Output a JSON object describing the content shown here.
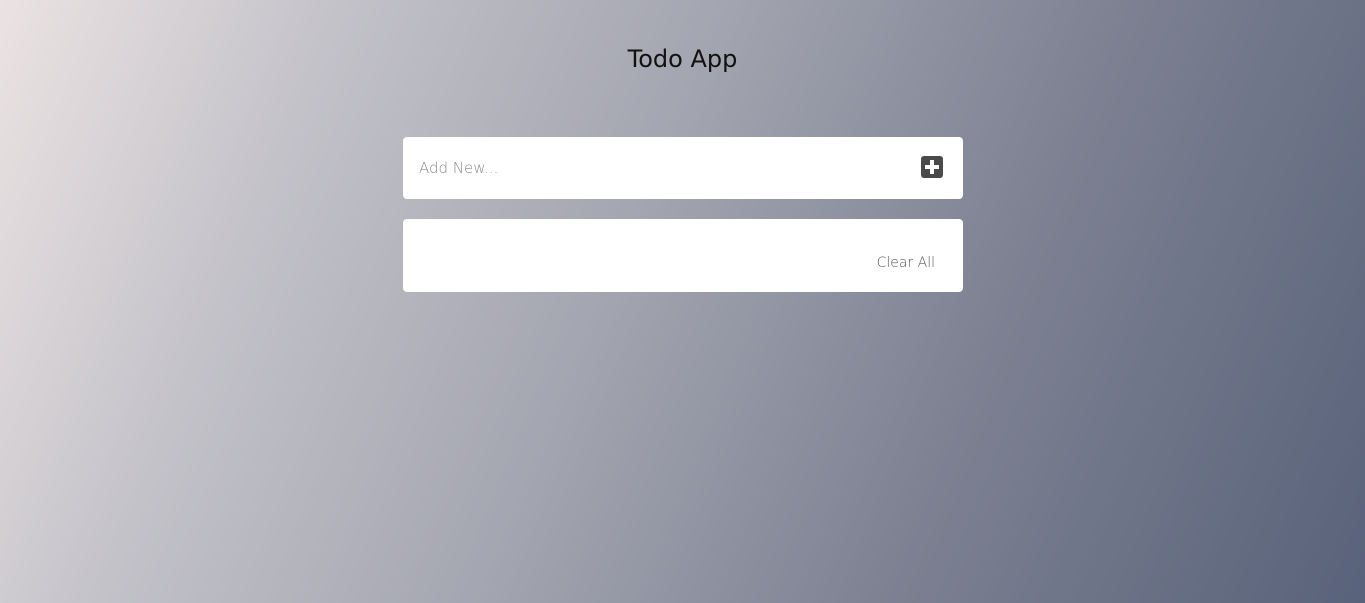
{
  "app": {
    "title": "Todo App"
  },
  "add_form": {
    "placeholder": "Add New...",
    "value": "",
    "add_button_icon": "plus-square-icon"
  },
  "todo_list": {
    "items": [],
    "clear_all_label": "Clear All"
  }
}
